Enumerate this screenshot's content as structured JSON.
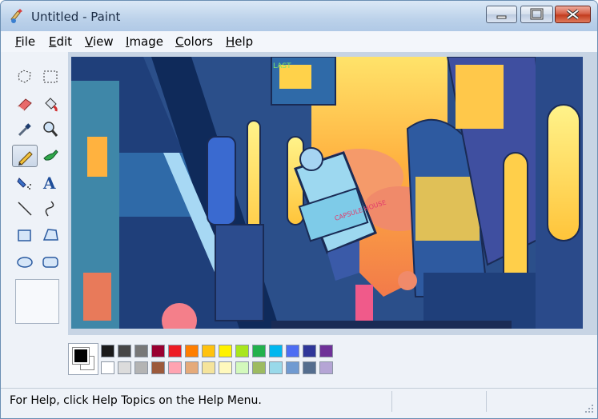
{
  "window": {
    "title": "Untitled - Paint"
  },
  "menu": [
    {
      "key": "F",
      "rest": "ile"
    },
    {
      "key": "E",
      "rest": "dit"
    },
    {
      "key": "V",
      "rest": "iew"
    },
    {
      "key": "I",
      "rest": "mage"
    },
    {
      "key": "C",
      "rest": "olors"
    },
    {
      "key": "H",
      "rest": "elp"
    }
  ],
  "tools": [
    "free-form-select",
    "select",
    "eraser",
    "fill-with-color",
    "pick-color",
    "magnifier",
    "pencil",
    "brush",
    "airbrush",
    "text",
    "line",
    "curve",
    "rectangle",
    "polygon",
    "ellipse",
    "rounded-rectangle"
  ],
  "selected_tool": "pencil",
  "colors": {
    "foreground": "#000000",
    "background": "#ffffff",
    "palette_row1": [
      "#1a1a1a",
      "#464646",
      "#787878",
      "#990030",
      "#ed1c24",
      "#ff7e00",
      "#ffc20e",
      "#fff200",
      "#a8e61d",
      "#22b14c",
      "#00b7ef",
      "#4d6df3",
      "#2f3699",
      "#6f3198"
    ],
    "palette_row2": [
      "#ffffff",
      "#dcdcdc",
      "#b4b4b4",
      "#9c5a3c",
      "#ffa3b1",
      "#e5aa7a",
      "#f5e49c",
      "#fff9bd",
      "#d3f9bc",
      "#9dbb61",
      "#99d9ea",
      "#709ad1",
      "#546d8e",
      "#b5a5d5"
    ]
  },
  "status": {
    "text": "For Help, click Help Topics on the Help Menu."
  },
  "canvas": {
    "sign_capsule": "CAPSULE HOUSE",
    "sign_top": "LAST"
  }
}
